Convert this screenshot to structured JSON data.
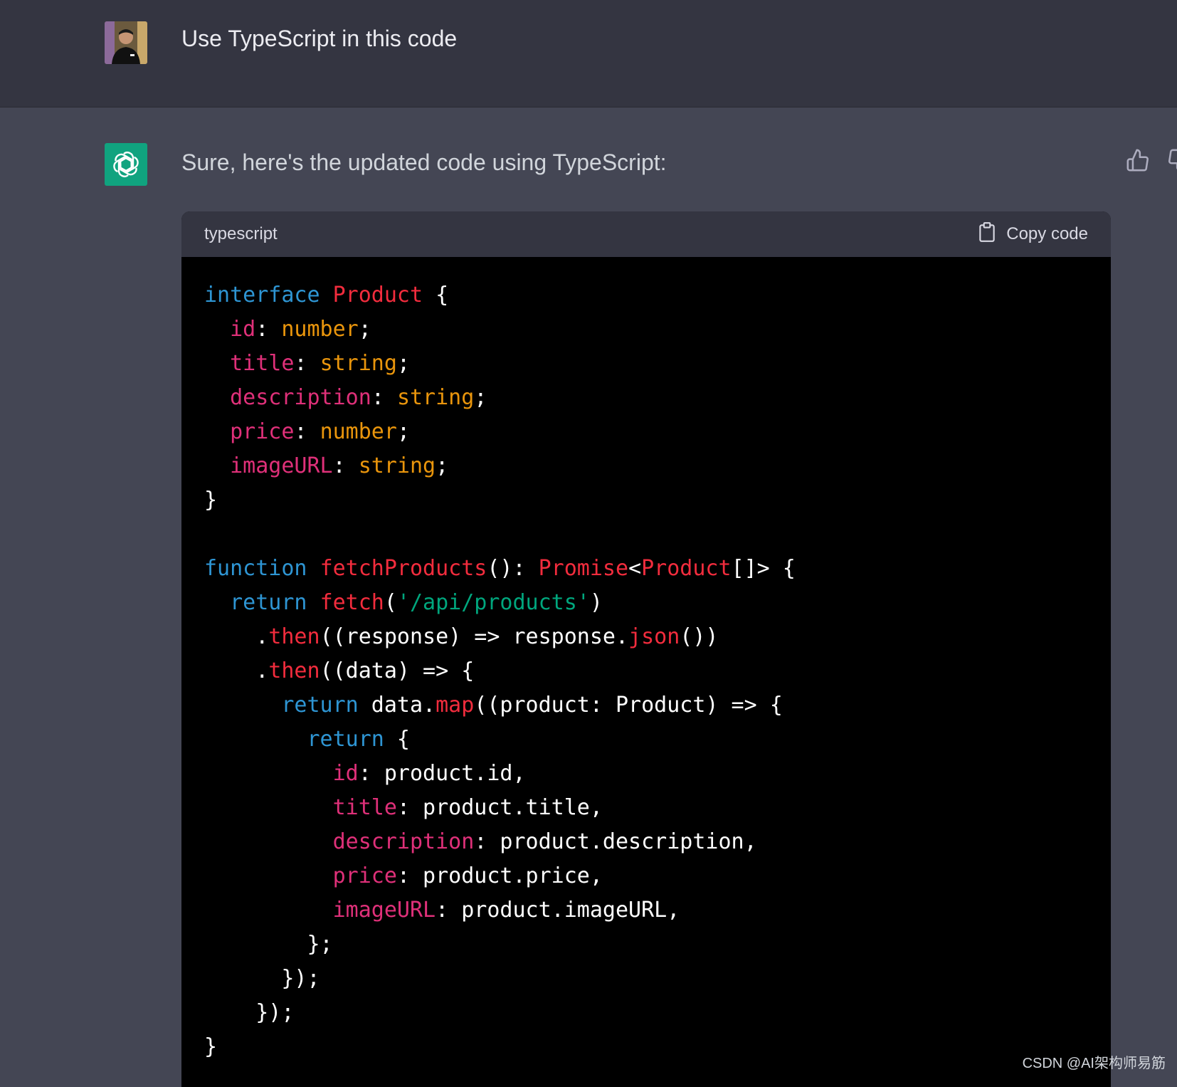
{
  "user_message": {
    "text": "Use TypeScript in this code"
  },
  "assistant_message": {
    "intro": "Sure, here's the updated code using TypeScript:"
  },
  "code_block": {
    "language": "typescript",
    "copy_label": "Copy code",
    "lines": [
      [
        {
          "t": "interface",
          "c": "kw"
        },
        {
          "t": " ",
          "c": "plain"
        },
        {
          "t": "Product",
          "c": "cls"
        },
        {
          "t": " {",
          "c": "plain"
        }
      ],
      [
        {
          "t": "  ",
          "c": "plain"
        },
        {
          "t": "id",
          "c": "prop"
        },
        {
          "t": ": ",
          "c": "plain"
        },
        {
          "t": "number",
          "c": "type"
        },
        {
          "t": ";",
          "c": "plain"
        }
      ],
      [
        {
          "t": "  ",
          "c": "plain"
        },
        {
          "t": "title",
          "c": "prop"
        },
        {
          "t": ": ",
          "c": "plain"
        },
        {
          "t": "string",
          "c": "type"
        },
        {
          "t": ";",
          "c": "plain"
        }
      ],
      [
        {
          "t": "  ",
          "c": "plain"
        },
        {
          "t": "description",
          "c": "prop"
        },
        {
          "t": ": ",
          "c": "plain"
        },
        {
          "t": "string",
          "c": "type"
        },
        {
          "t": ";",
          "c": "plain"
        }
      ],
      [
        {
          "t": "  ",
          "c": "plain"
        },
        {
          "t": "price",
          "c": "prop"
        },
        {
          "t": ": ",
          "c": "plain"
        },
        {
          "t": "number",
          "c": "type"
        },
        {
          "t": ";",
          "c": "plain"
        }
      ],
      [
        {
          "t": "  ",
          "c": "plain"
        },
        {
          "t": "imageURL",
          "c": "prop"
        },
        {
          "t": ": ",
          "c": "plain"
        },
        {
          "t": "string",
          "c": "type"
        },
        {
          "t": ";",
          "c": "plain"
        }
      ],
      [
        {
          "t": "}",
          "c": "plain"
        }
      ],
      [],
      [
        {
          "t": "function",
          "c": "kw"
        },
        {
          "t": " ",
          "c": "plain"
        },
        {
          "t": "fetchProducts",
          "c": "fn"
        },
        {
          "t": "(): ",
          "c": "plain"
        },
        {
          "t": "Promise",
          "c": "cls"
        },
        {
          "t": "<",
          "c": "plain"
        },
        {
          "t": "Product",
          "c": "cls"
        },
        {
          "t": "[]> {",
          "c": "plain"
        }
      ],
      [
        {
          "t": "  ",
          "c": "plain"
        },
        {
          "t": "return",
          "c": "kw"
        },
        {
          "t": " ",
          "c": "plain"
        },
        {
          "t": "fetch",
          "c": "fn"
        },
        {
          "t": "(",
          "c": "plain"
        },
        {
          "t": "'/api/products'",
          "c": "str"
        },
        {
          "t": ")",
          "c": "plain"
        }
      ],
      [
        {
          "t": "    .",
          "c": "plain"
        },
        {
          "t": "then",
          "c": "fn"
        },
        {
          "t": "((response) => response.",
          "c": "plain"
        },
        {
          "t": "json",
          "c": "fn"
        },
        {
          "t": "())",
          "c": "plain"
        }
      ],
      [
        {
          "t": "    .",
          "c": "plain"
        },
        {
          "t": "then",
          "c": "fn"
        },
        {
          "t": "((data) => {",
          "c": "plain"
        }
      ],
      [
        {
          "t": "      ",
          "c": "plain"
        },
        {
          "t": "return",
          "c": "kw"
        },
        {
          "t": " data.",
          "c": "plain"
        },
        {
          "t": "map",
          "c": "fn"
        },
        {
          "t": "((product: Product) => {",
          "c": "plain"
        }
      ],
      [
        {
          "t": "        ",
          "c": "plain"
        },
        {
          "t": "return",
          "c": "kw"
        },
        {
          "t": " {",
          "c": "plain"
        }
      ],
      [
        {
          "t": "          ",
          "c": "plain"
        },
        {
          "t": "id",
          "c": "prop"
        },
        {
          "t": ": product.id,",
          "c": "plain"
        }
      ],
      [
        {
          "t": "          ",
          "c": "plain"
        },
        {
          "t": "title",
          "c": "prop"
        },
        {
          "t": ": product.title,",
          "c": "plain"
        }
      ],
      [
        {
          "t": "          ",
          "c": "plain"
        },
        {
          "t": "description",
          "c": "prop"
        },
        {
          "t": ": product.description,",
          "c": "plain"
        }
      ],
      [
        {
          "t": "          ",
          "c": "plain"
        },
        {
          "t": "price",
          "c": "prop"
        },
        {
          "t": ": product.price,",
          "c": "plain"
        }
      ],
      [
        {
          "t": "          ",
          "c": "plain"
        },
        {
          "t": "imageURL",
          "c": "prop"
        },
        {
          "t": ": product.imageURL,",
          "c": "plain"
        }
      ],
      [
        {
          "t": "        };",
          "c": "plain"
        }
      ],
      [
        {
          "t": "      });",
          "c": "plain"
        }
      ],
      [
        {
          "t": "    });",
          "c": "plain"
        }
      ],
      [
        {
          "t": "}",
          "c": "plain"
        }
      ]
    ]
  },
  "watermark": "CSDN @AI架构师易筋",
  "colors": {
    "user_bg": "#343541",
    "assistant_bg": "#444654",
    "code_bg": "#000000",
    "code_header_bg": "#343541",
    "bot_avatar": "#10a37f",
    "keyword": "#2e95d3",
    "class_name": "#f22c3d",
    "property": "#df3079",
    "type": "#e9950c",
    "string": "#00a67d"
  },
  "icons": [
    "user-avatar",
    "chatgpt-logo-icon",
    "thumbs-up-icon",
    "thumbs-down-icon",
    "clipboard-icon"
  ]
}
